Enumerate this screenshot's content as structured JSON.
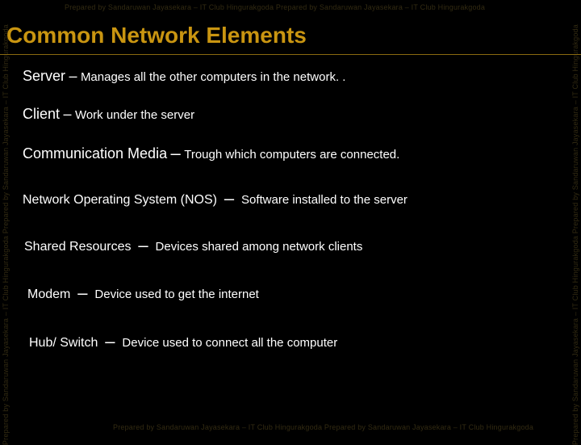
{
  "watermark": "Prepared by Sandaruwan Jayasekara – IT Club Hingurakgoda Prepared by Sandaruwan Jayasekara – IT Club Hingurakgoda",
  "watermark_long": "Prepared by Sandaruwan Jayasekara – IT Club Hingurakgoda Prepared by Sandaruwan Jayasekara – IT Club Hingurakgoda",
  "title": "Common Network Elements",
  "items": [
    {
      "term": "Server",
      "dash": "–",
      "desc": "Manages all the other computers in the network. ."
    },
    {
      "term": "Client",
      "dash": "–",
      "desc": "Work under the server"
    },
    {
      "term": "Communication Media",
      "dash": "–",
      "desc": "Trough which computers are connected."
    },
    {
      "term": "Network Operating System (NOS)",
      "dash": "–",
      "desc": "Software installed to the server"
    },
    {
      "term": "Shared Resources",
      "dash": "–",
      "desc": "Devices shared among network clients"
    },
    {
      "term": "Modem",
      "dash": "–",
      "desc": "Device used to get the internet"
    },
    {
      "term": "Hub/ Switch",
      "dash": "–",
      "desc": "Device used to connect all the computer"
    }
  ]
}
